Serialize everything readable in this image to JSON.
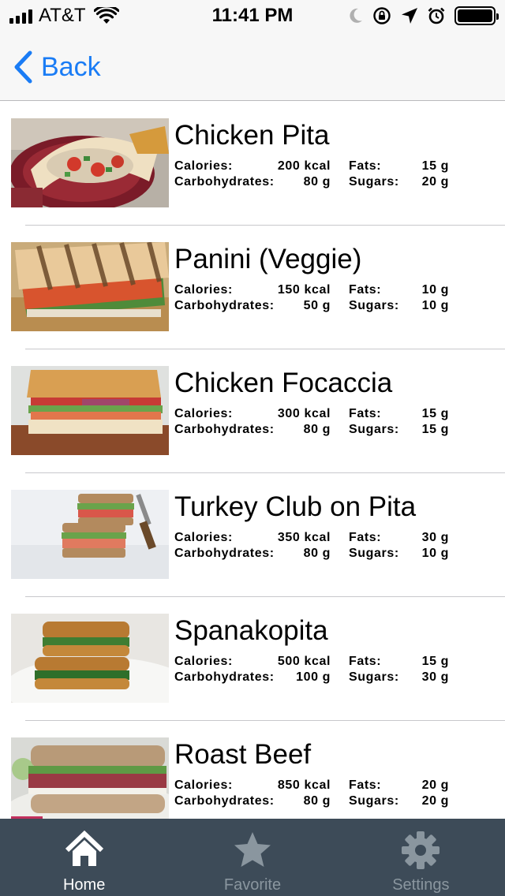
{
  "status_bar": {
    "carrier": "AT&T",
    "time": "11:41 PM"
  },
  "nav": {
    "back_label": "Back"
  },
  "labels": {
    "calories": "Calories:",
    "carbohydrates": "Carbohydrates:",
    "fats": "Fats:",
    "sugars": "Sugars:"
  },
  "items": [
    {
      "name": "Chicken Pita",
      "calories": "200 kcal",
      "carbohydrates": "80 g",
      "fats": "15 g",
      "sugars": "20 g"
    },
    {
      "name": "Panini (Veggie)",
      "calories": "150 kcal",
      "carbohydrates": "50 g",
      "fats": "10 g",
      "sugars": "10 g"
    },
    {
      "name": "Chicken Focaccia",
      "calories": "300 kcal",
      "carbohydrates": "80 g",
      "fats": "15 g",
      "sugars": "15 g"
    },
    {
      "name": "Turkey Club on Pita",
      "calories": "350 kcal",
      "carbohydrates": "80 g",
      "fats": "30 g",
      "sugars": "10 g"
    },
    {
      "name": "Spanakopita",
      "calories": "500 kcal",
      "carbohydrates": "100 g",
      "fats": "15 g",
      "sugars": "30 g"
    },
    {
      "name": "Roast Beef",
      "calories": "850 kcal",
      "carbohydrates": "80 g",
      "fats": "20 g",
      "sugars": "20 g"
    }
  ],
  "tabs": [
    {
      "label": "Home",
      "icon": "home-icon",
      "active": true
    },
    {
      "label": "Favorite",
      "icon": "star-icon",
      "active": false
    },
    {
      "label": "Settings",
      "icon": "gear-icon",
      "active": false
    }
  ],
  "colors": {
    "accent": "#1a7cf5",
    "tab_bar": "#3d4b58",
    "tab_active": "#ffffff",
    "tab_inactive": "#8a969f"
  }
}
